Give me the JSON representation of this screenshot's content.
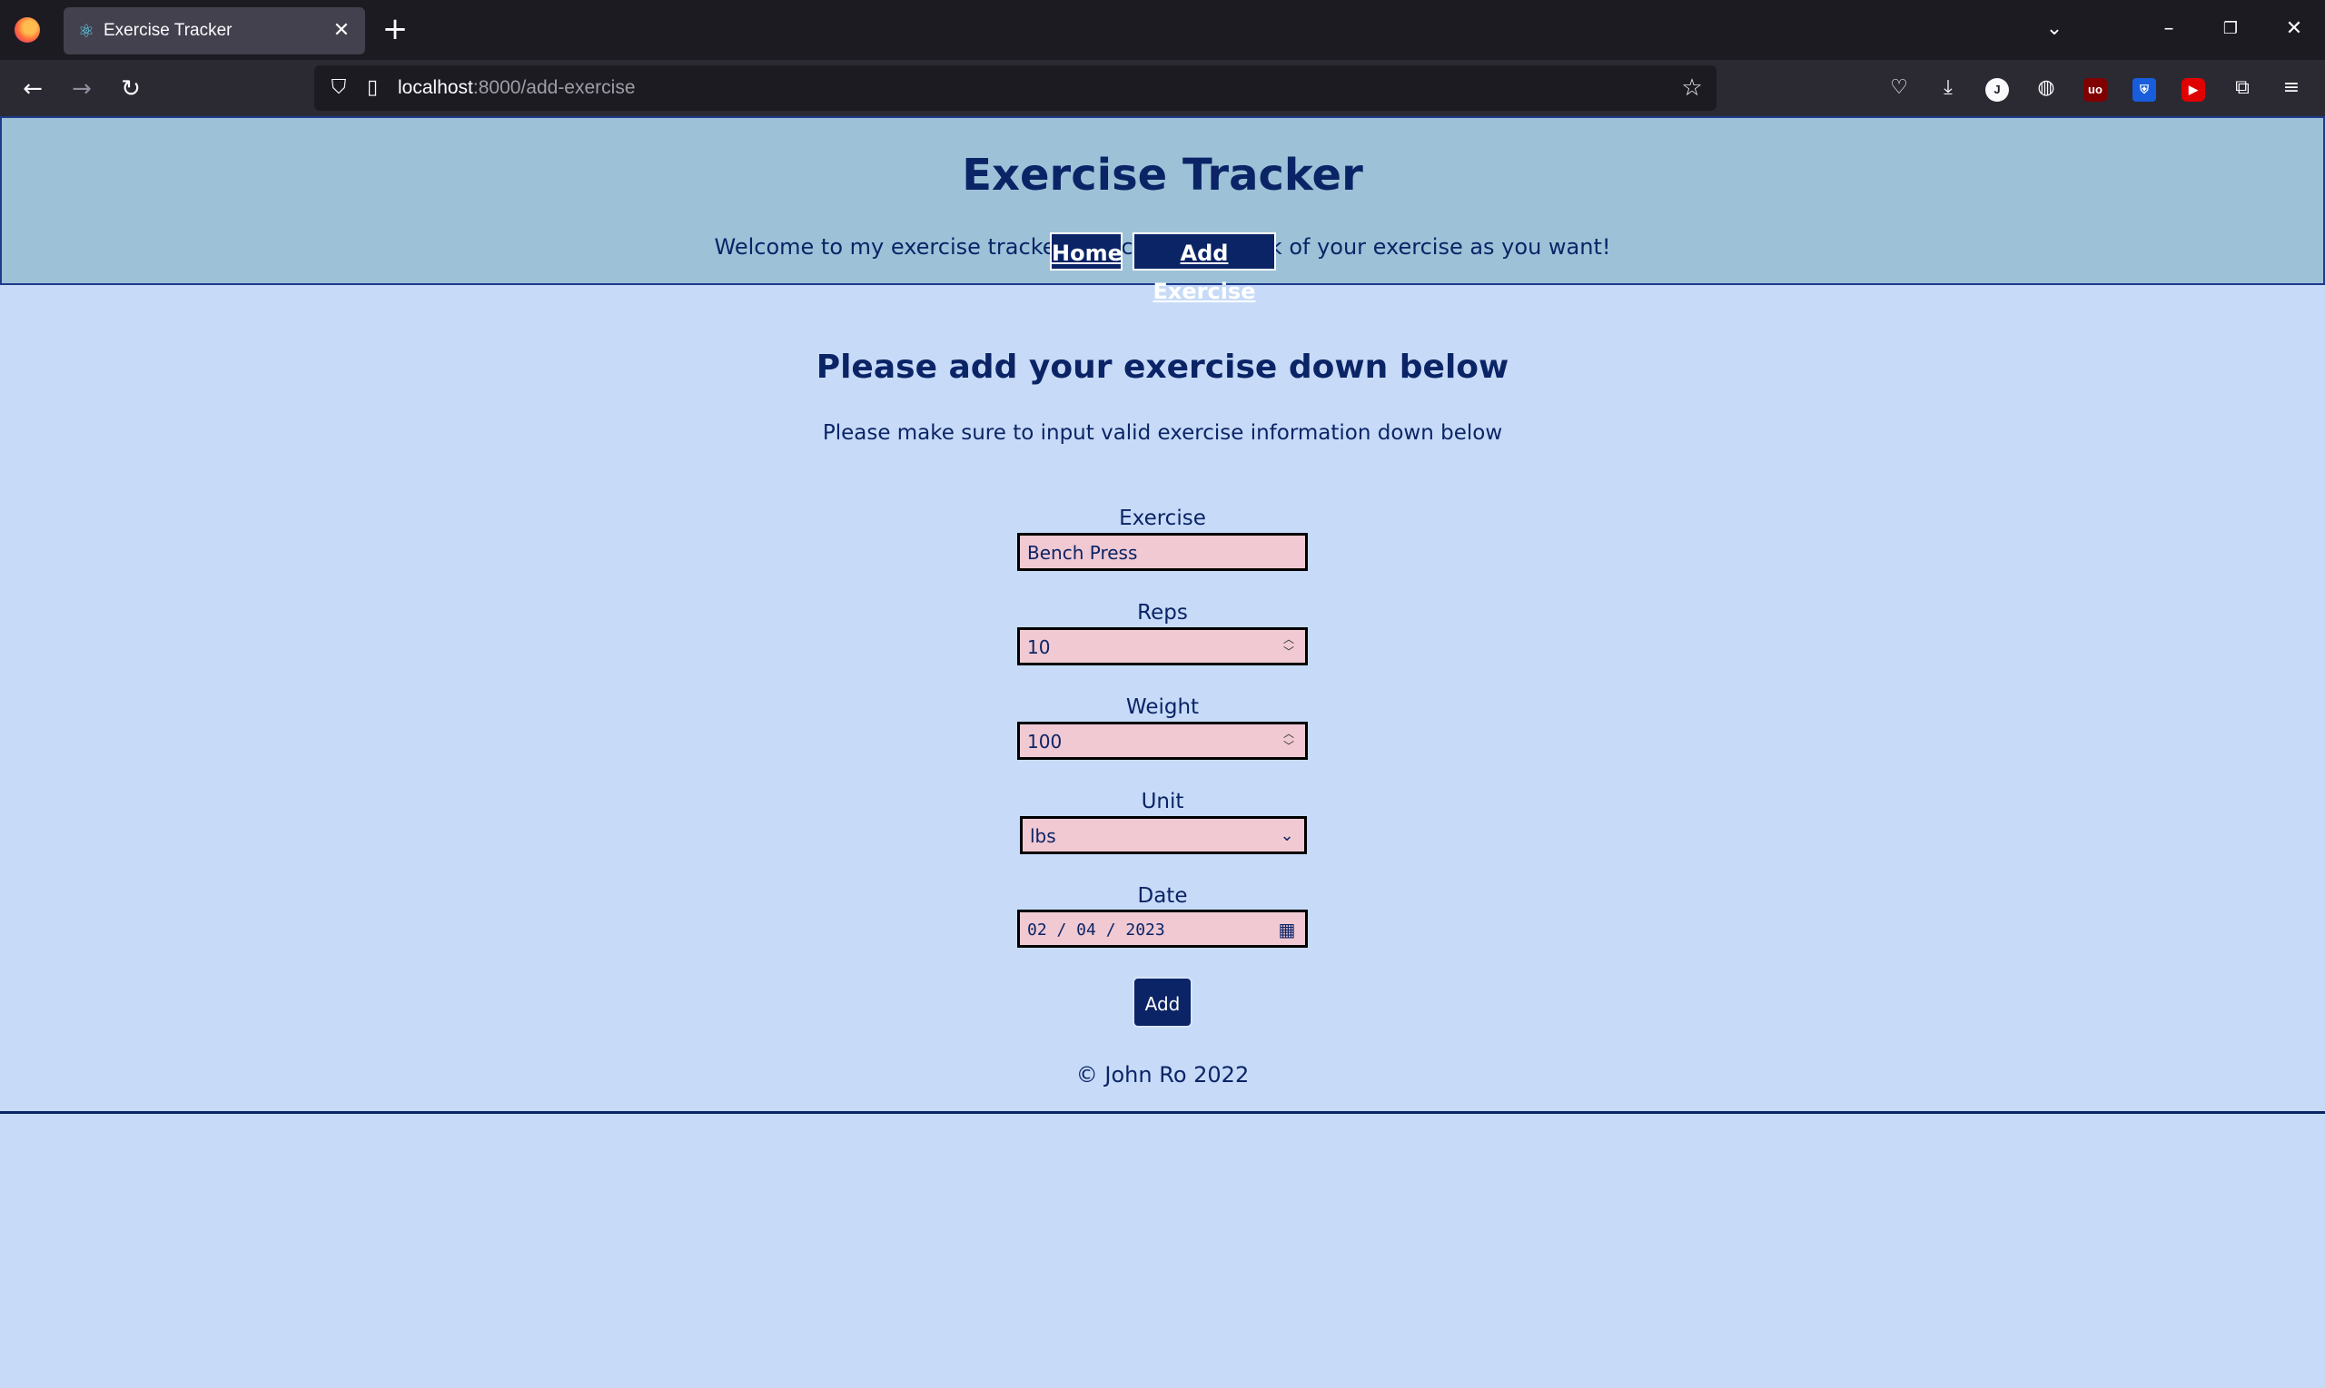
{
  "browser": {
    "tab_title": "Exercise Tracker",
    "tab_icon": "react-icon",
    "url_host": "localhost",
    "url_path": ":8000/add-exercise",
    "toolbar_icons": [
      "pocket-icon",
      "download-icon",
      "profile-icon",
      "extension-icon",
      "ublock-icon",
      "bitwarden-icon",
      "youtube-icon",
      "extensions-icon",
      "menu-icon"
    ]
  },
  "header": {
    "title": "Exercise Tracker",
    "welcome": "Welcome to my exercise tracker. You can keep track of your exercise as you want!"
  },
  "nav": {
    "home": "Home",
    "add_exercise": "Add Exercise"
  },
  "page": {
    "heading": "Please add your exercise down below",
    "subheading": "Please make sure to input valid exercise information down below"
  },
  "form": {
    "exercise_label": "Exercise",
    "exercise_value": "Bench Press",
    "reps_label": "Reps",
    "reps_value": "10",
    "weight_label": "Weight",
    "weight_value": "100",
    "unit_label": "Unit",
    "unit_value": "lbs",
    "date_label": "Date",
    "date_value": "02 / 04 / 2023",
    "submit": "Add"
  },
  "footer": {
    "text": "© John Ro 2022"
  },
  "colors": {
    "background": "#c7dbf8",
    "header_bg": "#9dc2d8",
    "primary": "#0b2466",
    "input_bg": "#f0c9d3"
  }
}
